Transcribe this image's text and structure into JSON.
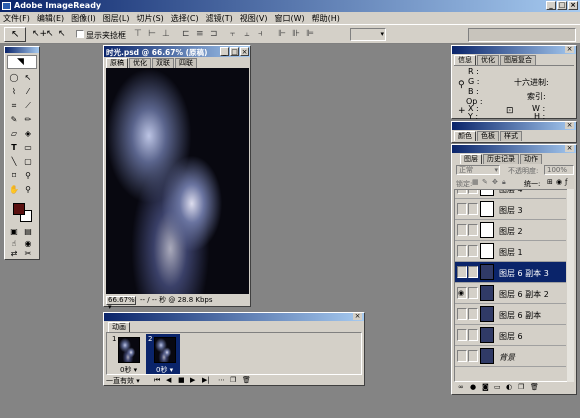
{
  "app": {
    "title": "Adobe ImageReady"
  },
  "menu": [
    "文件(F)",
    "编辑(E)",
    "图像(I)",
    "图层(L)",
    "切片(S)",
    "选择(C)",
    "滤镜(T)",
    "视图(V)",
    "窗口(W)",
    "帮助(H)"
  ],
  "optionsbar": {
    "show_bbox_label": "显示夹捻框"
  },
  "document": {
    "title": "时光.psd @ 66.67% (原稿)",
    "tabs": [
      "原稿",
      "优化",
      "双联",
      "四联"
    ],
    "zoom": "66.67%",
    "status": "-- / -- 秒 @ 28.8 Kbps"
  },
  "info_panel": {
    "tabs": [
      "信息",
      "优化",
      "图层复合"
    ],
    "labels": {
      "r": "R :",
      "g": "G :",
      "b": "B :",
      "op": "Op :",
      "hex": "十六进制:",
      "index": "索引:",
      "x": "X :",
      "y": "Y :",
      "w": "W :",
      "h": "H :"
    }
  },
  "color_panel": {
    "tabs": [
      "颜色",
      "色板",
      "样式"
    ]
  },
  "layers_panel": {
    "tabs": [
      "图层",
      "历史记录",
      "动作"
    ],
    "blend_mode": "正常",
    "opacity_label": "不透明度:",
    "opacity_value": "100%",
    "lock_label": "锁定:",
    "unify_label": "统一:",
    "layers": [
      {
        "name": "图层 4",
        "selected": false,
        "eye": false
      },
      {
        "name": "图层 3",
        "selected": false,
        "eye": false
      },
      {
        "name": "图层 2",
        "selected": false,
        "eye": false
      },
      {
        "name": "图层 1",
        "selected": false,
        "eye": false
      },
      {
        "name": "图层 6 副本 3",
        "selected": true,
        "eye": false
      },
      {
        "name": "图层 6 副本 2",
        "selected": false,
        "eye": true
      },
      {
        "name": "图层 6 副本",
        "selected": false,
        "eye": false
      },
      {
        "name": "图层 6",
        "selected": false,
        "eye": false
      },
      {
        "name": "背景",
        "selected": false,
        "eye": false
      }
    ]
  },
  "animation_panel": {
    "tab": "动画",
    "frames": [
      {
        "number": "1",
        "delay": "0秒 ▾",
        "selected": false
      },
      {
        "number": "2",
        "delay": "0秒 ▾",
        "selected": true
      }
    ],
    "loop": "一直有效 ▾"
  },
  "colors": {
    "foreground": "#5a1010",
    "background": "#ffffff",
    "title_active": "#0a246a",
    "selection": "#0a246a"
  }
}
